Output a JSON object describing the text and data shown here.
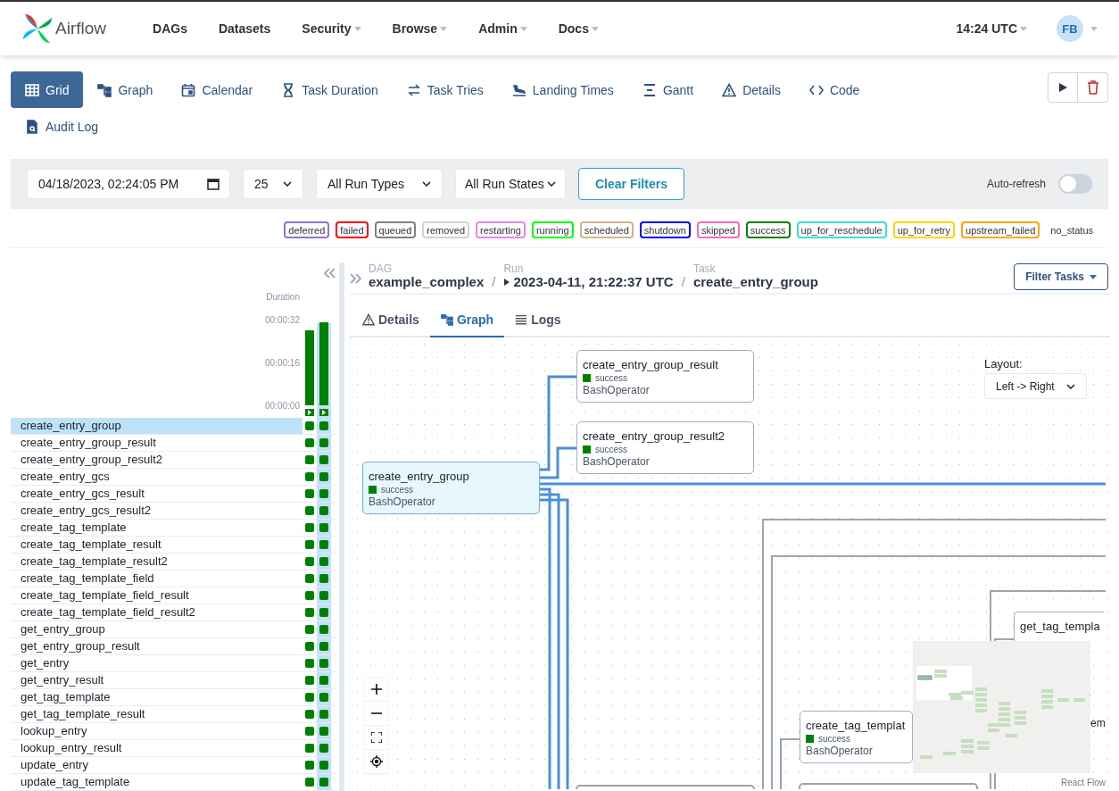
{
  "header": {
    "logo": "Airflow",
    "nav": [
      {
        "label": "DAGs",
        "has_menu": false
      },
      {
        "label": "Datasets",
        "has_menu": false
      },
      {
        "label": "Security",
        "has_menu": true
      },
      {
        "label": "Browse",
        "has_menu": true
      },
      {
        "label": "Admin",
        "has_menu": true
      },
      {
        "label": "Docs",
        "has_menu": true
      }
    ],
    "time": "14:24 UTC",
    "avatar": "FB"
  },
  "view_tabs": [
    {
      "label": "Grid",
      "selected": true
    },
    {
      "label": "Graph",
      "selected": false
    },
    {
      "label": "Calendar",
      "selected": false
    },
    {
      "label": "Task Duration",
      "selected": false
    },
    {
      "label": "Task Tries",
      "selected": false
    },
    {
      "label": "Landing Times",
      "selected": false
    },
    {
      "label": "Gantt",
      "selected": false
    },
    {
      "label": "Details",
      "selected": false
    },
    {
      "label": "Code",
      "selected": false
    },
    {
      "label": "Audit Log",
      "selected": false
    }
  ],
  "filters": {
    "date": "04/18/2023, 02:24:05 PM",
    "limit": "25",
    "run_type": "All Run Types",
    "run_state": "All Run States",
    "clear": "Clear Filters",
    "auto_refresh": {
      "label": "Auto-refresh",
      "on": false
    }
  },
  "legend": [
    {
      "label": "deferred",
      "color": "#9370db"
    },
    {
      "label": "failed",
      "color": "#ff0000"
    },
    {
      "label": "queued",
      "color": "#808080"
    },
    {
      "label": "removed",
      "color": "#d3d3d3"
    },
    {
      "label": "restarting",
      "color": "#ee82ee"
    },
    {
      "label": "running",
      "color": "#00ff00"
    },
    {
      "label": "scheduled",
      "color": "#d2b48c"
    },
    {
      "label": "shutdown",
      "color": "#0000ff"
    },
    {
      "label": "skipped",
      "color": "#ff69b4"
    },
    {
      "label": "success",
      "color": "#008000"
    },
    {
      "label": "up_for_reschedule",
      "color": "#40e0d0"
    },
    {
      "label": "up_for_retry",
      "color": "#ffd700"
    },
    {
      "label": "upstream_failed",
      "color": "#ffa500"
    },
    {
      "label": "no_status"
    }
  ],
  "grid": {
    "chart_data": {
      "type": "bar",
      "categories": [
        null,
        null
      ],
      "ylim": [
        0,
        32
      ],
      "yticks": [
        {
          "value": 0,
          "label": "00:00:00"
        },
        {
          "value": 16,
          "label": "00:00:16"
        },
        {
          "value": 32,
          "label": "00:00:32"
        }
      ],
      "series": [
        {
          "name": "Duration",
          "color": "#008000",
          "values": [
            28,
            31
          ]
        }
      ]
    },
    "runs": [
      {
        "selected": false
      },
      {
        "selected": true
      }
    ],
    "tasks": [
      {
        "name": "create_entry_group",
        "selected": true,
        "instances": [
          {
            "color": "#008000"
          },
          {
            "color": "#008000"
          }
        ]
      },
      {
        "name": "create_entry_group_result",
        "selected": false,
        "instances": [
          {
            "color": "#008000"
          },
          {
            "color": "#008000"
          }
        ]
      },
      {
        "name": "create_entry_group_result2",
        "selected": false,
        "instances": [
          {
            "color": "#008000"
          },
          {
            "color": "#008000"
          }
        ]
      },
      {
        "name": "create_entry_gcs",
        "selected": false,
        "instances": [
          {
            "color": "#008000"
          },
          {
            "color": "#008000"
          }
        ]
      },
      {
        "name": "create_entry_gcs_result",
        "selected": false,
        "instances": [
          {
            "color": "#008000"
          },
          {
            "color": "#008000"
          }
        ]
      },
      {
        "name": "create_entry_gcs_result2",
        "selected": false,
        "instances": [
          {
            "color": "#008000"
          },
          {
            "color": "#008000"
          }
        ]
      },
      {
        "name": "create_tag_template",
        "selected": false,
        "instances": [
          {
            "color": "#008000"
          },
          {
            "color": "#008000"
          }
        ]
      },
      {
        "name": "create_tag_template_result",
        "selected": false,
        "instances": [
          {
            "color": "#008000"
          },
          {
            "color": "#008000"
          }
        ]
      },
      {
        "name": "create_tag_template_result2",
        "selected": false,
        "instances": [
          {
            "color": "#008000"
          },
          {
            "color": "#008000"
          }
        ]
      },
      {
        "name": "create_tag_template_field",
        "selected": false,
        "instances": [
          {
            "color": "#008000"
          },
          {
            "color": "#008000"
          }
        ]
      },
      {
        "name": "create_tag_template_field_result",
        "selected": false,
        "instances": [
          {
            "color": "#008000"
          },
          {
            "color": "#008000"
          }
        ]
      },
      {
        "name": "create_tag_template_field_result2",
        "selected": false,
        "instances": [
          {
            "color": "#008000"
          },
          {
            "color": "#008000"
          }
        ]
      },
      {
        "name": "get_entry_group",
        "selected": false,
        "instances": [
          {
            "color": "#008000"
          },
          {
            "color": "#008000"
          }
        ]
      },
      {
        "name": "get_entry_group_result",
        "selected": false,
        "instances": [
          {
            "color": "#008000"
          },
          {
            "color": "#008000"
          }
        ]
      },
      {
        "name": "get_entry",
        "selected": false,
        "instances": [
          {
            "color": "#008000"
          },
          {
            "color": "#008000"
          }
        ]
      },
      {
        "name": "get_entry_result",
        "selected": false,
        "instances": [
          {
            "color": "#008000"
          },
          {
            "color": "#008000"
          }
        ]
      },
      {
        "name": "get_tag_template",
        "selected": false,
        "instances": [
          {
            "color": "#008000"
          },
          {
            "color": "#008000"
          }
        ]
      },
      {
        "name": "get_tag_template_result",
        "selected": false,
        "instances": [
          {
            "color": "#008000"
          },
          {
            "color": "#008000"
          }
        ]
      },
      {
        "name": "lookup_entry",
        "selected": false,
        "instances": [
          {
            "color": "#008000"
          },
          {
            "color": "#008000"
          }
        ]
      },
      {
        "name": "lookup_entry_result",
        "selected": false,
        "instances": [
          {
            "color": "#008000"
          },
          {
            "color": "#008000"
          }
        ]
      },
      {
        "name": "update_entry",
        "selected": false,
        "instances": [
          {
            "color": "#008000"
          },
          {
            "color": "#008000"
          }
        ]
      },
      {
        "name": "update_tag_template",
        "selected": false,
        "instances": [
          {
            "color": "#008000"
          },
          {
            "color": "#008000"
          }
        ]
      }
    ]
  },
  "details": {
    "breadcrumb": [
      {
        "label": "DAG",
        "value": "example_complex"
      },
      {
        "separator": "/",
        "label": "Run",
        "value": "2023-04-11, 21:22:37 UTC"
      },
      {
        "separator": "/",
        "label": "Task",
        "value": "create_entry_group"
      }
    ],
    "filter_button": "Filter Tasks",
    "tabs": [
      {
        "label": "Details",
        "selected": false
      },
      {
        "label": "Graph",
        "selected": true
      },
      {
        "label": "Logs",
        "selected": false
      }
    ],
    "graph": {
      "layout_label": "Layout:",
      "layout": "Left -> Right",
      "attribution": "React Flow",
      "nodes": [
        {
          "title": "create_entry_group_result",
          "state": "success",
          "color": "#008000",
          "operator": "BashOperator",
          "selected": false
        },
        {
          "title": "create_entry_group_result2",
          "state": "success",
          "color": "#008000",
          "operator": "BashOperator",
          "selected": false
        },
        {
          "title": "create_entry_group",
          "state": "success",
          "color": "#008000",
          "operator": "BashOperator",
          "selected": true
        },
        {
          "title": "create_tag_templat",
          "state": "success",
          "color": "#008000",
          "operator": "BashOperator",
          "selected": false
        },
        {
          "title": "get_tag_templa",
          "selected": false
        },
        {
          "title": "em"
        }
      ]
    }
  }
}
